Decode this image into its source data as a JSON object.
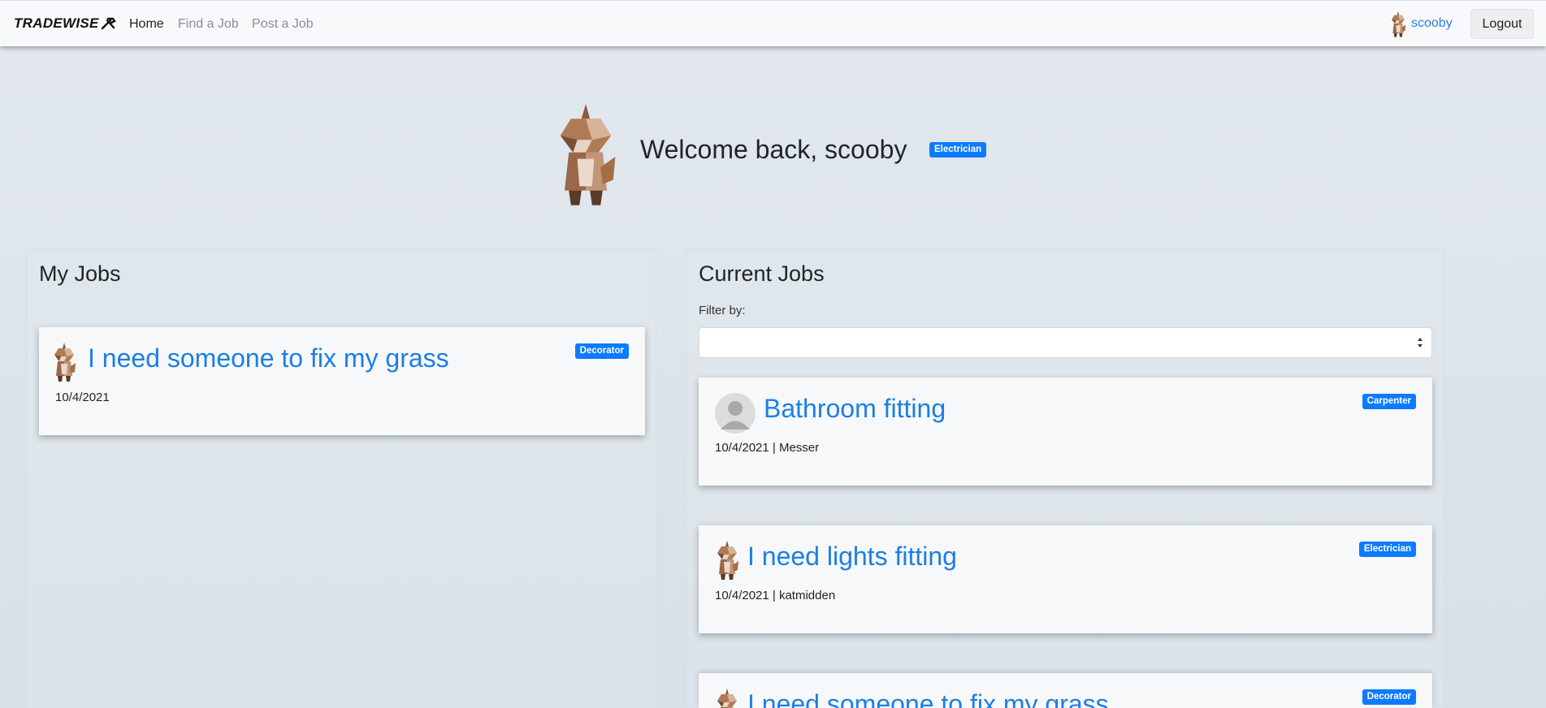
{
  "nav": {
    "brand": "TRADEWISE",
    "links": [
      {
        "label": "Home"
      },
      {
        "label": "Find a Job"
      },
      {
        "label": "Post a Job"
      }
    ],
    "username": "scooby",
    "logout_label": "Logout"
  },
  "hero": {
    "welcome": "Welcome back, scooby",
    "trade_badge": "Electrician"
  },
  "my_jobs": {
    "title": "My Jobs",
    "items": [
      {
        "title": "I need someone to fix my grass",
        "meta": "10/4/2021",
        "badge": "Decorator",
        "avatar": "fox-avatar"
      }
    ]
  },
  "current_jobs": {
    "title": "Current Jobs",
    "filter_label": "Filter by:",
    "filter_value": "",
    "items": [
      {
        "title": "Bathroom fitting",
        "meta": "10/4/2021 | Messer",
        "badge": "Carpenter",
        "avatar": "default-user-avatar"
      },
      {
        "title": "I need lights fitting",
        "meta": "10/4/2021 | katmidden",
        "badge": "Electrician",
        "avatar": "fox-avatar"
      },
      {
        "title": "I need someone to fix my grass",
        "meta": "",
        "badge": "Decorator",
        "avatar": "fox-avatar"
      }
    ]
  },
  "colors": {
    "accent": "#0d7bff",
    "link": "#1b7fe6",
    "background": "#dde5eb"
  }
}
